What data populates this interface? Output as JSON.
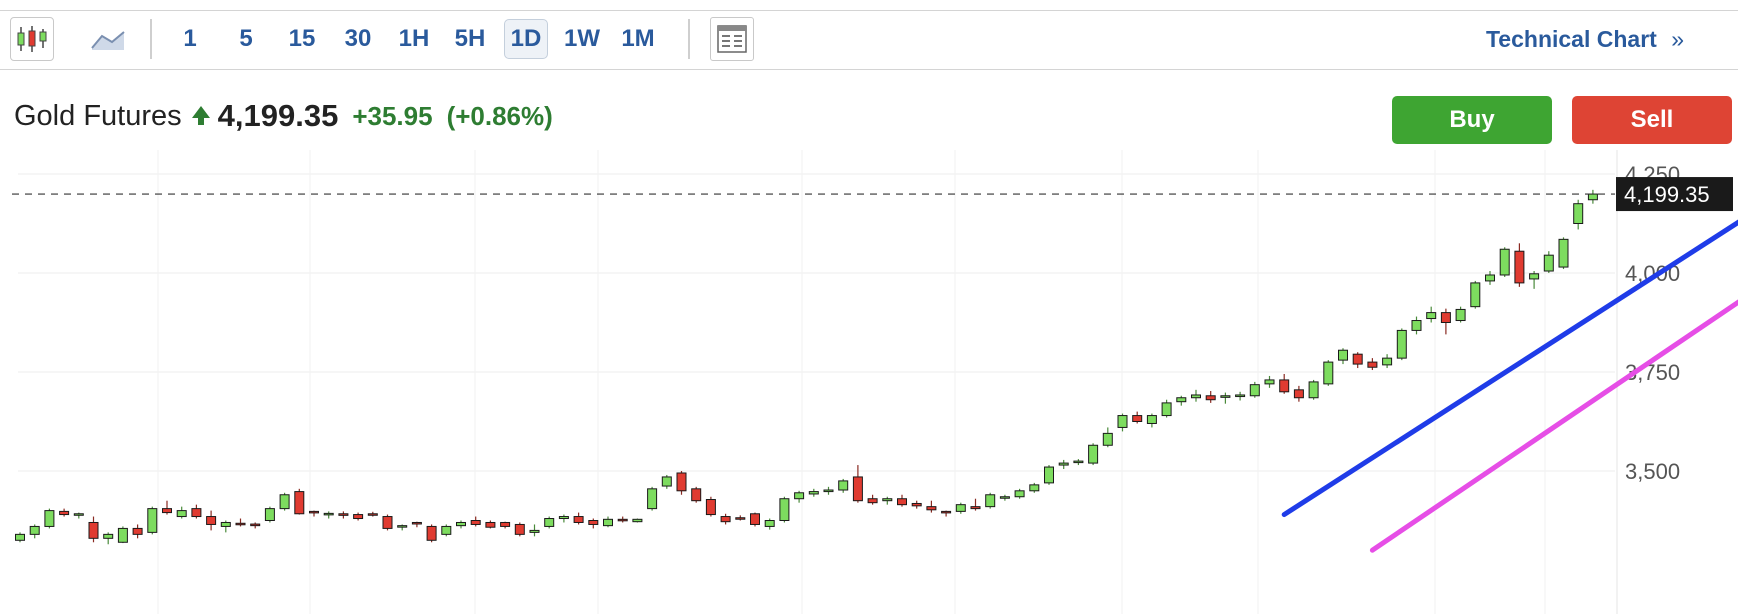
{
  "toolbar": {
    "timeframes": [
      "1",
      "5",
      "15",
      "30",
      "1H",
      "5H",
      "1D",
      "1W",
      "1M"
    ],
    "active_timeframe": "1D",
    "technical_chart_label": "Technical Chart",
    "technical_chart_chevron": "»",
    "icons": [
      "candlestick-chart-icon",
      "area-chart-icon",
      "layout-icon"
    ]
  },
  "quote": {
    "name": "Gold Futures",
    "direction_icon": "up-arrow-icon",
    "price": "4,199.35",
    "change": "+35.95",
    "change_pct": "(+0.86%)"
  },
  "trade": {
    "buy_label": "Buy",
    "sell_label": "Sell"
  },
  "colors": {
    "up": "#7ddc5f",
    "down": "#e03b31",
    "trendline_upper": "#1f3ce8",
    "trendline_lower": "#e64ee6",
    "link": "#2a5a9c",
    "buy": "#3ea532",
    "sell": "#de4434"
  },
  "chart_data": {
    "type": "candlestick",
    "y_ticks": [
      "4,250",
      "4,000",
      "3,750",
      "3,500"
    ],
    "y_tick_values": [
      4250,
      4000,
      3750,
      3500
    ],
    "ylim": [
      3300,
      4270
    ],
    "grid": true,
    "current_price": 4199.35,
    "current_price_label": "4,199.35",
    "candles": [
      [
        3325,
        3345,
        3320,
        3340
      ],
      [
        3340,
        3365,
        3330,
        3360
      ],
      [
        3360,
        3405,
        3355,
        3400
      ],
      [
        3398,
        3405,
        3385,
        3390
      ],
      [
        3390,
        3395,
        3380,
        3392
      ],
      [
        3370,
        3385,
        3320,
        3330
      ],
      [
        3330,
        3345,
        3315,
        3340
      ],
      [
        3320,
        3360,
        3318,
        3355
      ],
      [
        3355,
        3365,
        3330,
        3340
      ],
      [
        3345,
        3410,
        3340,
        3405
      ],
      [
        3405,
        3425,
        3390,
        3395
      ],
      [
        3385,
        3410,
        3380,
        3400
      ],
      [
        3405,
        3415,
        3380,
        3385
      ],
      [
        3385,
        3400,
        3350,
        3365
      ],
      [
        3360,
        3375,
        3345,
        3370
      ],
      [
        3368,
        3380,
        3360,
        3366
      ],
      [
        3366,
        3370,
        3355,
        3362
      ],
      [
        3375,
        3410,
        3370,
        3405
      ],
      [
        3405,
        3445,
        3400,
        3440
      ],
      [
        3448,
        3455,
        3390,
        3392
      ],
      [
        3398,
        3400,
        3385,
        3396
      ],
      [
        3392,
        3398,
        3380,
        3393
      ],
      [
        3392,
        3398,
        3380,
        3388
      ],
      [
        3390,
        3395,
        3375,
        3380
      ],
      [
        3392,
        3397,
        3385,
        3390
      ],
      [
        3385,
        3390,
        3350,
        3355
      ],
      [
        3360,
        3365,
        3350,
        3362
      ],
      [
        3370,
        3372,
        3358,
        3368
      ],
      [
        3360,
        3365,
        3320,
        3325
      ],
      [
        3340,
        3365,
        3335,
        3360
      ],
      [
        3362,
        3375,
        3355,
        3370
      ],
      [
        3375,
        3385,
        3360,
        3365
      ],
      [
        3370,
        3375,
        3355,
        3358
      ],
      [
        3370,
        3372,
        3355,
        3360
      ],
      [
        3365,
        3370,
        3335,
        3340
      ],
      [
        3345,
        3365,
        3335,
        3350
      ],
      [
        3360,
        3385,
        3355,
        3380
      ],
      [
        3380,
        3390,
        3370,
        3385
      ],
      [
        3385,
        3395,
        3365,
        3370
      ],
      [
        3375,
        3380,
        3355,
        3365
      ],
      [
        3362,
        3385,
        3358,
        3378
      ],
      [
        3378,
        3385,
        3370,
        3375
      ],
      [
        3372,
        3380,
        3370,
        3378
      ],
      [
        3405,
        3460,
        3400,
        3455
      ],
      [
        3462,
        3490,
        3455,
        3485
      ],
      [
        3495,
        3500,
        3440,
        3450
      ],
      [
        3455,
        3460,
        3420,
        3425
      ],
      [
        3428,
        3435,
        3385,
        3390
      ],
      [
        3385,
        3392,
        3365,
        3372
      ],
      [
        3382,
        3388,
        3375,
        3380
      ],
      [
        3392,
        3395,
        3360,
        3365
      ],
      [
        3360,
        3380,
        3352,
        3375
      ],
      [
        3375,
        3435,
        3370,
        3430
      ],
      [
        3430,
        3450,
        3420,
        3445
      ],
      [
        3442,
        3455,
        3435,
        3448
      ],
      [
        3448,
        3460,
        3440,
        3452
      ],
      [
        3452,
        3480,
        3445,
        3475
      ],
      [
        3485,
        3515,
        3420,
        3425
      ],
      [
        3430,
        3440,
        3415,
        3420
      ],
      [
        3425,
        3435,
        3415,
        3430
      ],
      [
        3430,
        3440,
        3410,
        3415
      ],
      [
        3418,
        3425,
        3405,
        3412
      ],
      [
        3410,
        3425,
        3395,
        3402
      ],
      [
        3398,
        3400,
        3385,
        3395
      ],
      [
        3398,
        3420,
        3392,
        3415
      ],
      [
        3410,
        3430,
        3400,
        3405
      ],
      [
        3410,
        3445,
        3405,
        3440
      ],
      [
        3432,
        3440,
        3425,
        3435
      ],
      [
        3435,
        3455,
        3430,
        3450
      ],
      [
        3450,
        3470,
        3445,
        3465
      ],
      [
        3470,
        3515,
        3465,
        3510
      ],
      [
        3515,
        3528,
        3505,
        3520
      ],
      [
        3523,
        3530,
        3515,
        3525
      ],
      [
        3520,
        3570,
        3515,
        3565
      ],
      [
        3565,
        3610,
        3560,
        3595
      ],
      [
        3610,
        3645,
        3600,
        3640
      ],
      [
        3640,
        3650,
        3620,
        3625
      ],
      [
        3620,
        3645,
        3610,
        3640
      ],
      [
        3640,
        3680,
        3635,
        3672
      ],
      [
        3675,
        3690,
        3665,
        3685
      ],
      [
        3685,
        3705,
        3675,
        3692
      ],
      [
        3690,
        3702,
        3672,
        3680
      ],
      [
        3686,
        3698,
        3670,
        3690
      ],
      [
        3688,
        3700,
        3678,
        3692
      ],
      [
        3690,
        3725,
        3685,
        3718
      ],
      [
        3720,
        3740,
        3710,
        3730
      ],
      [
        3730,
        3745,
        3695,
        3700
      ],
      [
        3705,
        3715,
        3675,
        3685
      ],
      [
        3685,
        3730,
        3680,
        3725
      ],
      [
        3720,
        3780,
        3715,
        3775
      ],
      [
        3780,
        3810,
        3770,
        3805
      ],
      [
        3795,
        3800,
        3760,
        3770
      ],
      [
        3775,
        3785,
        3755,
        3762
      ],
      [
        3768,
        3795,
        3760,
        3785
      ],
      [
        3785,
        3860,
        3780,
        3855
      ],
      [
        3855,
        3890,
        3845,
        3880
      ],
      [
        3885,
        3915,
        3875,
        3900
      ],
      [
        3900,
        3910,
        3845,
        3875
      ],
      [
        3880,
        3915,
        3875,
        3908
      ],
      [
        3915,
        3980,
        3910,
        3975
      ],
      [
        3980,
        4005,
        3970,
        3995
      ],
      [
        3995,
        4065,
        3990,
        4060
      ],
      [
        4055,
        4075,
        3965,
        3975
      ],
      [
        3985,
        4005,
        3960,
        3998
      ],
      [
        4005,
        4055,
        4000,
        4045
      ],
      [
        4015,
        4090,
        4010,
        4085
      ],
      [
        4125,
        4185,
        4110,
        4175
      ],
      [
        4185,
        4210,
        4175,
        4199.35
      ]
    ],
    "trendlines": [
      {
        "name": "upper",
        "from": [
          86,
          3390
        ],
        "to": [
          122,
          4250
        ]
      },
      {
        "name": "lower",
        "from": [
          92,
          3300
        ],
        "to": [
          122,
          4055
        ]
      }
    ]
  }
}
